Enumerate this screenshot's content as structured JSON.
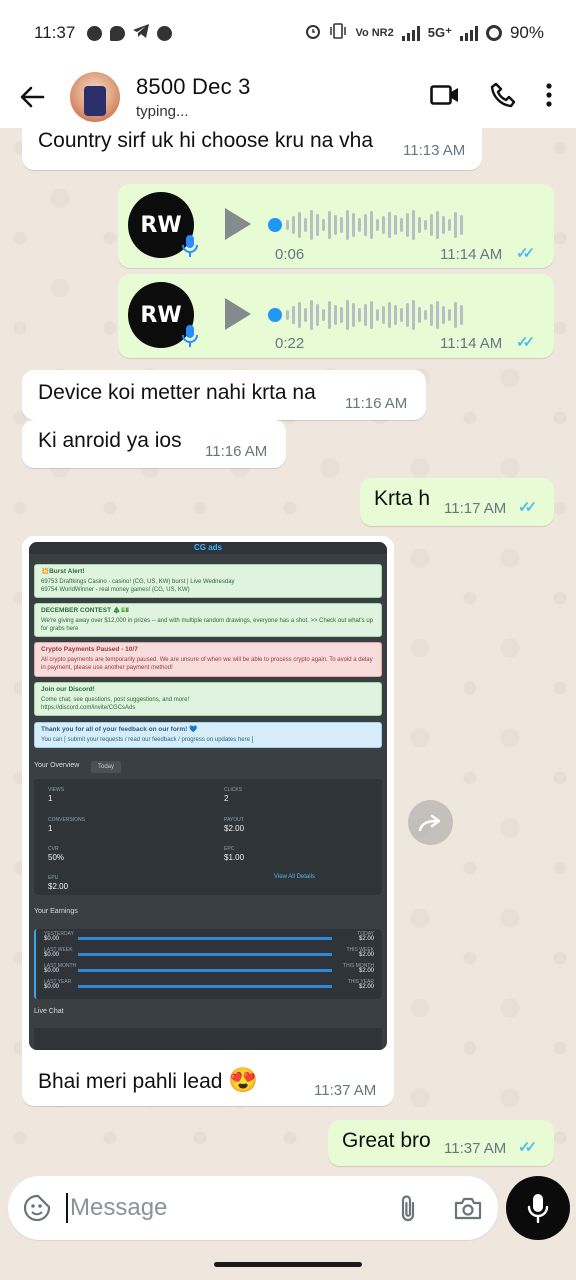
{
  "status_bar": {
    "time": "11:37",
    "network_label": "5G⁺",
    "volte_label": "Vo NR2",
    "battery": "90%"
  },
  "header": {
    "contact_name": "8500 Dec 3",
    "contact_status": "typing..."
  },
  "messages": [
    {
      "type": "text",
      "dir": "in",
      "text": "Country sirf uk hi choose kru na vha",
      "time": "11:13 AM"
    },
    {
      "type": "voice",
      "dir": "out",
      "duration": "0:06",
      "time": "11:14 AM",
      "avatar_text": "RW"
    },
    {
      "type": "voice",
      "dir": "out",
      "duration": "0:22",
      "time": "11:14 AM",
      "avatar_text": "RW"
    },
    {
      "type": "text",
      "dir": "in",
      "text": "Device koi metter nahi krta na",
      "time": "11:16 AM"
    },
    {
      "type": "text",
      "dir": "in",
      "text": "Ki anroid ya ios",
      "time": "11:16 AM"
    },
    {
      "type": "text",
      "dir": "out",
      "text": "Krta h",
      "time": "11:17 AM"
    },
    {
      "type": "image",
      "dir": "in",
      "caption": "Bhai meri pahli lead",
      "emoji": "😍",
      "time": "11:37 AM"
    },
    {
      "type": "text",
      "dir": "out",
      "text": "Great bro",
      "time": "11:37 AM"
    }
  ],
  "screenshot": {
    "logo": "CG ads",
    "alerts": [
      {
        "title": "💥Burst Alert!",
        "lines": [
          "69753 Draftkings Casino - casino! (CG, US, KW) burst | Live Wednesday",
          "69754 WorldWinner - real money games! (CG, US, KW)"
        ],
        "tone": "green"
      },
      {
        "title": "DECEMBER CONTEST 🎄💵",
        "lines": [
          "We're giving away over $12,000 in prizes -- and with multiple random drawings, everyone has a shot. >> Check out what's up for grabs here"
        ],
        "tone": "green"
      },
      {
        "title": "Crypto Payments Paused - 10/7",
        "lines": [
          "All crypto payments are temporarily paused. We are unsure of when we will be able to process crypto again. To avoid a delay in payment, please use another payment method!"
        ],
        "tone": "red"
      },
      {
        "title": "Join our Discord!",
        "lines": [
          "Come chat, see questions, post suggestions, and more!",
          "https://discord.com/invite/CGCsAds"
        ],
        "tone": "green"
      },
      {
        "title": "Thank you for all of your feedback on our form! 💙",
        "lines": [
          "You can [ submit your requests / read our feedback / progress on updates here ]"
        ],
        "tone": "blue"
      }
    ],
    "overview_title": "Your Overview",
    "overview_filter": "Today",
    "stats": [
      {
        "label": "VIEWS",
        "value": "1"
      },
      {
        "label": "CLICKS",
        "value": "2"
      },
      {
        "label": "CONVERSIONS",
        "value": "1"
      },
      {
        "label": "PAYOUT",
        "value": "$2.00"
      },
      {
        "label": "CVR",
        "value": "50%"
      },
      {
        "label": "EPC",
        "value": "$1.00"
      },
      {
        "label": "EPU",
        "value": "$2.00"
      }
    ],
    "view_all": "View All Details",
    "earnings_title": "Your Earnings",
    "earnings": [
      {
        "left_label": "YESTERDAY",
        "left_value": "$0.00",
        "right_label": "TODAY",
        "right_value": "$2.00"
      },
      {
        "left_label": "LAST WEEK",
        "left_value": "$0.00",
        "right_label": "THIS WEEK",
        "right_value": "$2.00"
      },
      {
        "left_label": "LAST MONTH",
        "left_value": "$0.00",
        "right_label": "THIS MONTH",
        "right_value": "$2.00"
      },
      {
        "left_label": "LAST YEAR",
        "left_value": "$0.00",
        "right_label": "THIS YEAR",
        "right_value": "$2.00"
      }
    ],
    "live_chat_title": "Live Chat"
  },
  "input": {
    "placeholder": "Message"
  },
  "colors": {
    "chat_background": "#efe7dd",
    "outgoing_bubble": "#e7fcd5",
    "incoming_bubble": "#ffffff",
    "read_ticks": "#53bdeb",
    "voice_progress": "#2196f3"
  }
}
